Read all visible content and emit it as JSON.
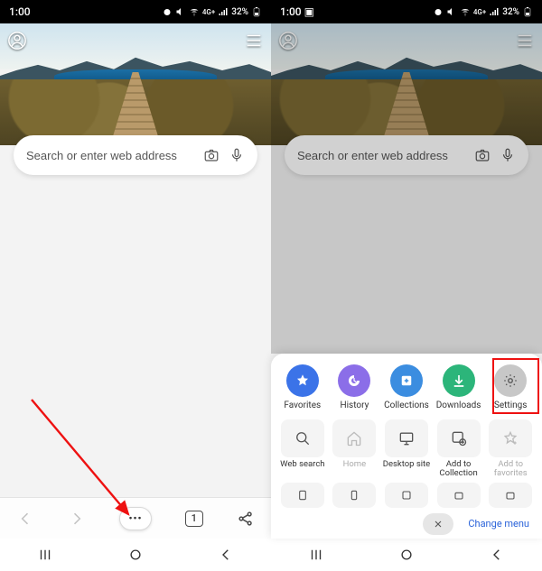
{
  "status": {
    "time": "1:00",
    "battery": "32%",
    "picIndicator": "🖼"
  },
  "search": {
    "placeholder": "Search or enter web address"
  },
  "toolbar": {
    "tabCount": "1",
    "moreGlyph": "•••"
  },
  "sheet": {
    "row1": [
      {
        "label": "Favorites",
        "color": "c-blue"
      },
      {
        "label": "History",
        "color": "c-purple"
      },
      {
        "label": "Collections",
        "color": "c-teal"
      },
      {
        "label": "Downloads",
        "color": "c-green"
      },
      {
        "label": "Settings",
        "color": "c-gray"
      }
    ],
    "row2": [
      {
        "label": "Web search"
      },
      {
        "label": "Home",
        "grey": true
      },
      {
        "label": "Desktop site"
      },
      {
        "label": "Add to Collection"
      },
      {
        "label": "Add to favorites",
        "grey": true
      }
    ],
    "changeMenu": "Change menu"
  }
}
